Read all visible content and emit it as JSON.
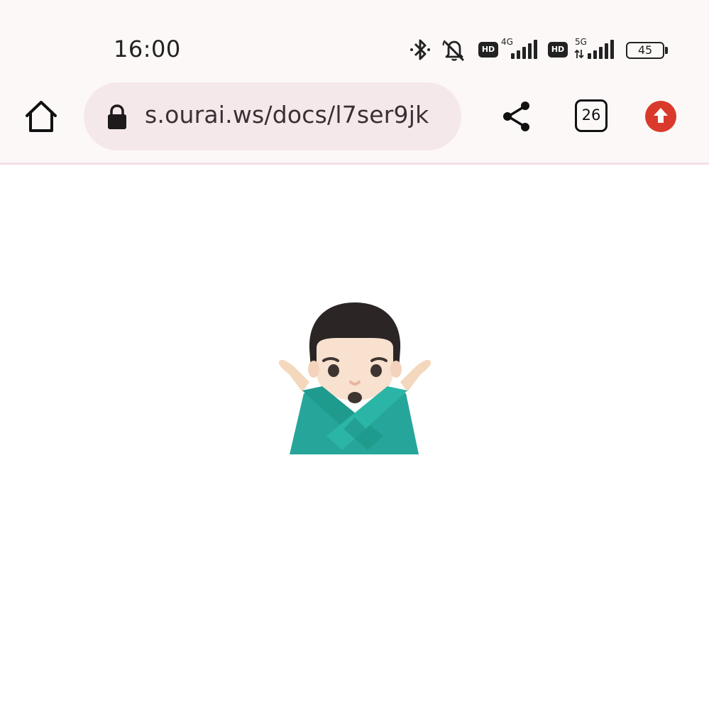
{
  "status_bar": {
    "time": "16:00",
    "icons": [
      "bluetooth-icon",
      "silent-icon",
      "hd-icon",
      "signal-4g-icon",
      "hd-icon",
      "signal-5g-icon",
      "battery-icon"
    ],
    "hd_label": "HD",
    "net1": "4G",
    "net2": "5G",
    "battery": "45"
  },
  "toolbar": {
    "url": "s.ourai.ws/docs/l7ser9jk",
    "tab_count": "26",
    "icons": [
      "home-icon",
      "lock-icon",
      "share-icon",
      "tab-switcher-icon",
      "update-icon"
    ]
  },
  "colors": {
    "toolbar_bg": "#fcf8f7",
    "urlbar_bg": "#f5e8eb",
    "update_red": "#d93a2b",
    "emoji_teal": "#26a69a"
  },
  "content": {
    "emoji": "man-gesturing-no-icon"
  }
}
